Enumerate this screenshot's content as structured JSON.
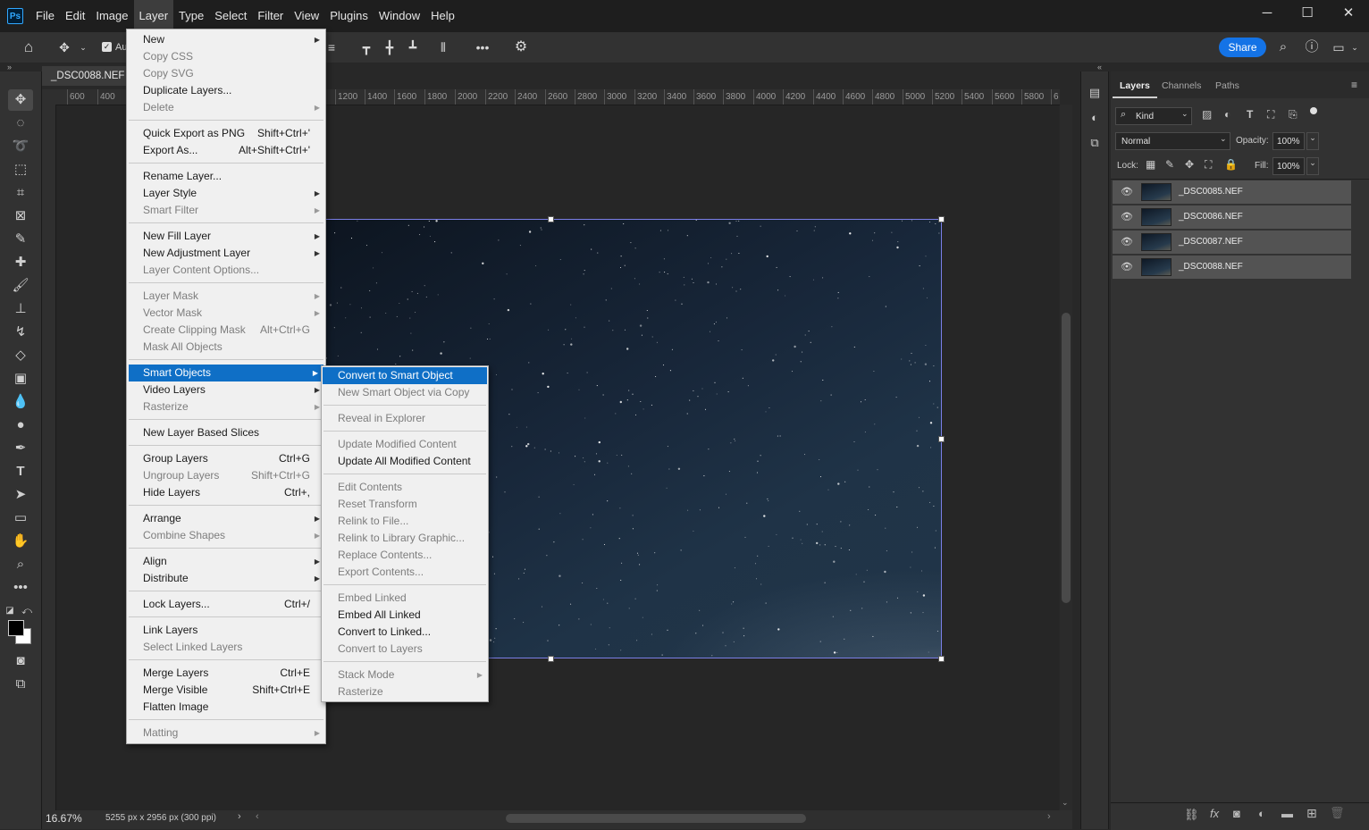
{
  "app": {
    "logo_text": "Ps"
  },
  "menubar": [
    "File",
    "Edit",
    "Image",
    "Layer",
    "Type",
    "Select",
    "Filter",
    "View",
    "Plugins",
    "Window",
    "Help"
  ],
  "options_bar": {
    "auto_label": "Au",
    "share_label": "Share"
  },
  "document": {
    "tab_title": "_DSC0088.NEF @",
    "zoom": "16.67%",
    "info": "5255 px x 2956 px (300 ppi)"
  },
  "ruler_labels": [
    "600",
    "400",
    "1200",
    "1400",
    "1600",
    "1800",
    "2000",
    "2200",
    "2400",
    "2600",
    "2800",
    "3000",
    "3200",
    "3400",
    "3600",
    "3800",
    "4000",
    "4200",
    "4400",
    "4600",
    "4800",
    "5000",
    "5200",
    "5400",
    "5600",
    "5800",
    "6"
  ],
  "layer_menu": {
    "groups": [
      [
        {
          "label": "New",
          "sub": true
        },
        {
          "label": "Copy CSS",
          "disabled": true
        },
        {
          "label": "Copy SVG",
          "disabled": true
        },
        {
          "label": "Duplicate Layers..."
        },
        {
          "label": "Delete",
          "disabled": true,
          "sub": true
        }
      ],
      [
        {
          "label": "Quick Export as PNG",
          "shortcut": "Shift+Ctrl+'"
        },
        {
          "label": "Export As...",
          "shortcut": "Alt+Shift+Ctrl+'"
        }
      ],
      [
        {
          "label": "Rename Layer..."
        },
        {
          "label": "Layer Style",
          "sub": true
        },
        {
          "label": "Smart Filter",
          "disabled": true,
          "sub": true
        }
      ],
      [
        {
          "label": "New Fill Layer",
          "sub": true
        },
        {
          "label": "New Adjustment Layer",
          "sub": true
        },
        {
          "label": "Layer Content Options...",
          "disabled": true
        }
      ],
      [
        {
          "label": "Layer Mask",
          "disabled": true,
          "sub": true
        },
        {
          "label": "Vector Mask",
          "disabled": true,
          "sub": true
        },
        {
          "label": "Create Clipping Mask",
          "disabled": true,
          "shortcut": "Alt+Ctrl+G"
        },
        {
          "label": "Mask All Objects",
          "disabled": true
        }
      ],
      [
        {
          "label": "Smart Objects",
          "sub": true,
          "highlighted": true
        },
        {
          "label": "Video Layers",
          "sub": true
        },
        {
          "label": "Rasterize",
          "disabled": true,
          "sub": true
        }
      ],
      [
        {
          "label": "New Layer Based Slices"
        }
      ],
      [
        {
          "label": "Group Layers",
          "shortcut": "Ctrl+G"
        },
        {
          "label": "Ungroup Layers",
          "disabled": true,
          "shortcut": "Shift+Ctrl+G"
        },
        {
          "label": "Hide Layers",
          "shortcut": "Ctrl+,"
        }
      ],
      [
        {
          "label": "Arrange",
          "sub": true
        },
        {
          "label": "Combine Shapes",
          "disabled": true,
          "sub": true
        }
      ],
      [
        {
          "label": "Align",
          "sub": true
        },
        {
          "label": "Distribute",
          "sub": true
        }
      ],
      [
        {
          "label": "Lock Layers...",
          "shortcut": "Ctrl+/"
        }
      ],
      [
        {
          "label": "Link Layers"
        },
        {
          "label": "Select Linked Layers",
          "disabled": true
        }
      ],
      [
        {
          "label": "Merge Layers",
          "shortcut": "Ctrl+E"
        },
        {
          "label": "Merge Visible",
          "shortcut": "Shift+Ctrl+E"
        },
        {
          "label": "Flatten Image"
        }
      ],
      [
        {
          "label": "Matting",
          "disabled": true,
          "sub": true
        }
      ]
    ]
  },
  "smart_objects_menu": {
    "groups": [
      [
        {
          "label": "Convert to Smart Object",
          "highlighted": true
        },
        {
          "label": "New Smart Object via Copy",
          "disabled": true
        }
      ],
      [
        {
          "label": "Reveal in Explorer",
          "disabled": true
        }
      ],
      [
        {
          "label": "Update Modified Content",
          "disabled": true
        },
        {
          "label": "Update All Modified Content"
        }
      ],
      [
        {
          "label": "Edit Contents",
          "disabled": true
        },
        {
          "label": "Reset Transform",
          "disabled": true
        },
        {
          "label": "Relink to File...",
          "disabled": true
        },
        {
          "label": "Relink to Library Graphic...",
          "disabled": true
        },
        {
          "label": "Replace Contents...",
          "disabled": true
        },
        {
          "label": "Export Contents...",
          "disabled": true
        }
      ],
      [
        {
          "label": "Embed Linked",
          "disabled": true
        },
        {
          "label": "Embed All Linked"
        },
        {
          "label": "Convert to Linked..."
        },
        {
          "label": "Convert to Layers",
          "disabled": true
        }
      ],
      [
        {
          "label": "Stack Mode",
          "disabled": true,
          "sub": true
        },
        {
          "label": "Rasterize",
          "disabled": true
        }
      ]
    ]
  },
  "layers_panel": {
    "tabs": [
      "Layers",
      "Channels",
      "Paths"
    ],
    "filter_kind": "Kind",
    "blend_mode": "Normal",
    "opacity_label": "Opacity:",
    "opacity_value": "100%",
    "lock_label": "Lock:",
    "fill_label": "Fill:",
    "fill_value": "100%",
    "layers": [
      "_DSC0085.NEF",
      "_DSC0086.NEF",
      "_DSC0087.NEF",
      "_DSC0088.NEF"
    ]
  }
}
